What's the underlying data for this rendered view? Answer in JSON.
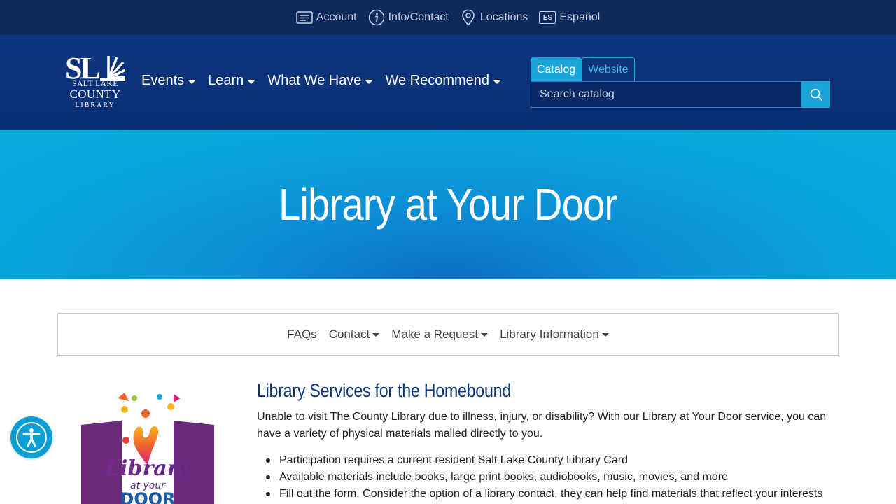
{
  "utility_bar": {
    "items": [
      {
        "label": "Account",
        "icon": "id-card-icon"
      },
      {
        "label": "Info/Contact",
        "icon": "info-icon"
      },
      {
        "label": "Locations",
        "icon": "map-pin-icon"
      },
      {
        "label": "Español",
        "icon": "es-icon",
        "icon_text": "ES"
      }
    ]
  },
  "logo": {
    "line1": "SALT LAKE",
    "line2": "COUNTY",
    "line3": "LIBRARY",
    "mark": "SL"
  },
  "main_nav": {
    "items": [
      {
        "label": "Events"
      },
      {
        "label": "Learn"
      },
      {
        "label": "What We Have"
      },
      {
        "label": "We Recommend"
      }
    ]
  },
  "search": {
    "tabs": [
      {
        "label": "Catalog",
        "active": true
      },
      {
        "label": "Website",
        "active": false
      }
    ],
    "placeholder": "Search catalog",
    "button_icon": "search-icon"
  },
  "hero": {
    "title": "Library at Your Door"
  },
  "sub_nav": {
    "items": [
      {
        "label": "FAQs"
      },
      {
        "label": "Contact"
      },
      {
        "label": "Make a Request"
      },
      {
        "label": "Library Information"
      }
    ]
  },
  "content": {
    "heading": "Library Services for the Homebound",
    "intro": "Unable to visit The County Library due to illness, injury, or disability? With our Library at Your Door service, you can have a variety of physical materials mailed directly to you.",
    "bullets": [
      "Participation requires a current resident Salt Lake County Library Card",
      "Available materials include books, large print books, audiobooks, music, movies, and more",
      "Fill out the form. Consider the option of a library contact, they can help find materials that reflect your interests"
    ],
    "promo_image": {
      "line1": "Library",
      "line2": "at your",
      "line3": "DOOR"
    }
  },
  "accessibility_button": {
    "icon": "accessibility-icon"
  },
  "colors": {
    "utility_bar": "#0d2a5c",
    "header": "#0d3580",
    "accent": "#1aa4d8",
    "hero": "#09acdd",
    "heading": "#0c3a7c"
  }
}
